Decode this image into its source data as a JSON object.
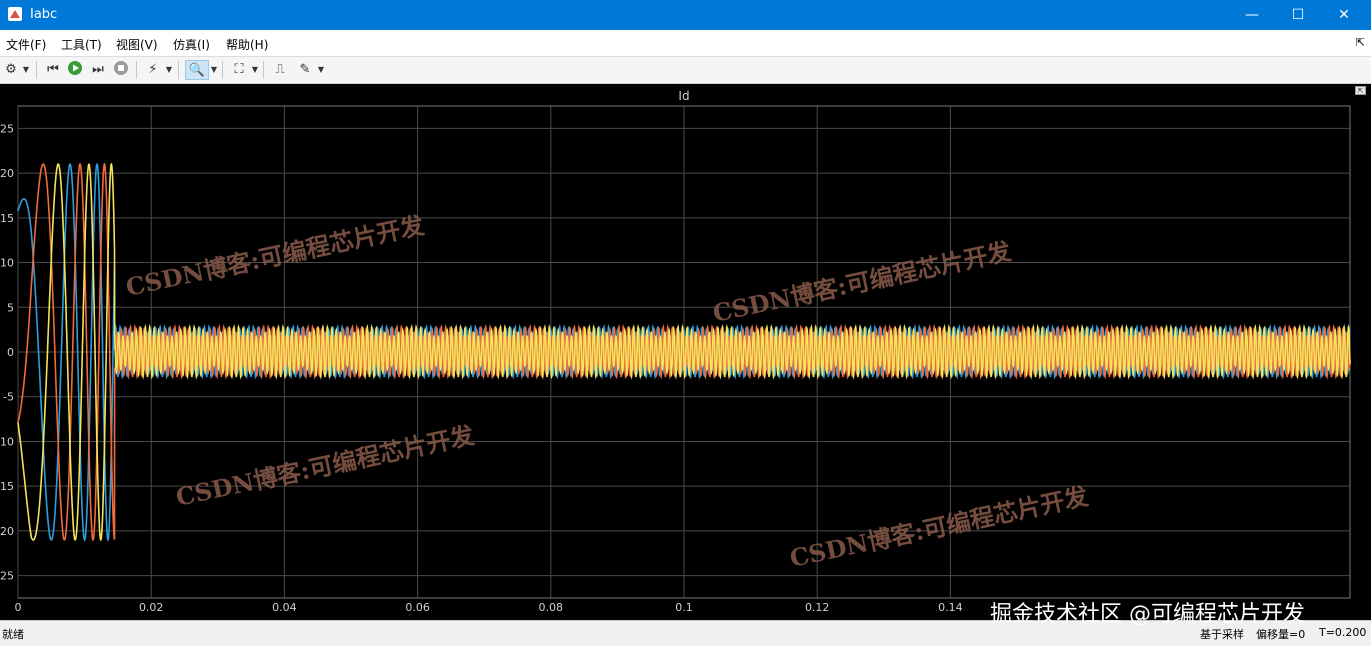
{
  "window": {
    "title": "Iabc",
    "minimize": "—",
    "maximize": "☐",
    "close": "✕"
  },
  "menu": {
    "items": [
      "文件(F)",
      "工具(T)",
      "视图(V)",
      "仿真(I)",
      "帮助(H)"
    ],
    "collapse_glyph": "⇱"
  },
  "toolbar": {
    "icons": [
      "settings-icon",
      "step-back-icon",
      "run-icon",
      "step-forward-icon",
      "stop-icon",
      "highlight-icon",
      "zoom-icon",
      "fit-view-icon",
      "triggers-icon",
      "style-icon"
    ]
  },
  "plot": {
    "title": "Id",
    "watermark": "CSDN博客:可编程芯片开发",
    "background": "#000000",
    "grid_color": "#4a4a4a",
    "axis_text_color": "#d0d0d0"
  },
  "chart_data": {
    "type": "line",
    "title": "Id",
    "xlabel": "",
    "ylabel": "",
    "xlim": [
      0,
      0.2
    ],
    "ylim": [
      -27.5,
      27.5
    ],
    "x_ticks": [
      0,
      0.02,
      0.04,
      0.06,
      0.08,
      0.1,
      0.12,
      0.14
    ],
    "x_tick_labels": [
      "0",
      "0.02",
      "0.04",
      "0.06",
      "0.08",
      "0.1",
      "0.12",
      "0.14"
    ],
    "y_ticks": [
      25,
      20,
      15,
      10,
      5,
      0,
      -5,
      -10,
      -15,
      -20,
      -25
    ],
    "y_tick_labels": [
      "25",
      "20",
      "15",
      "10",
      "5",
      "0",
      "-5",
      "-10",
      "-15",
      "-20",
      "-25"
    ],
    "grid": true,
    "transient_end": 0.0145,
    "transient_amplitude": 21,
    "steady_amplitude": 2.8,
    "series": [
      {
        "color": "#2d9ee0",
        "phase_deg": 90
      },
      {
        "color": "#f26b3a",
        "phase_deg": -30
      },
      {
        "color": "#f5e45a",
        "phase_deg": 210
      }
    ]
  },
  "statusbar": {
    "left": "就绪",
    "sample": "基于采样",
    "offset": "偏移量=0",
    "time": "T=0.200"
  },
  "corner_mark": "掘金技术社区 @可编程芯片开发"
}
